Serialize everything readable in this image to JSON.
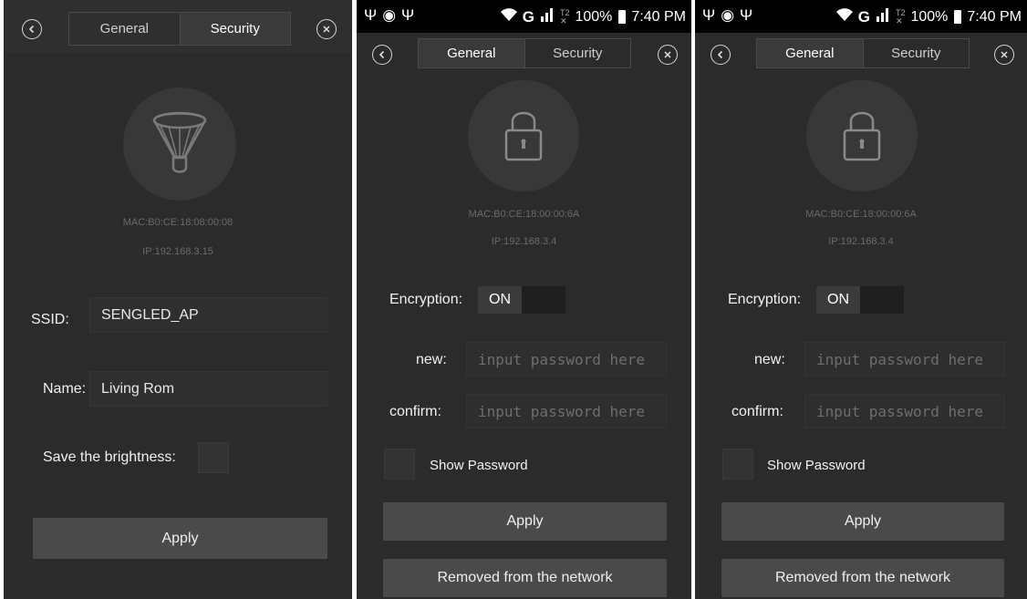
{
  "screen1": {
    "tabs": {
      "general": "General",
      "security": "Security"
    },
    "mac": "MAC:B0:CE:18:08:00:08",
    "ip": "IP:192.168.3.15",
    "ssid_label": "SSID:",
    "ssid_value": "SENGLED_AP",
    "name_label": "Name:",
    "name_value": "Living Rom",
    "save_brightness_label": "Save the brightness:",
    "apply_label": "Apply"
  },
  "screen2": {
    "status": {
      "battery": "100%",
      "time": "7:40 PM",
      "network": "G"
    },
    "tabs": {
      "general": "General",
      "security": "Security"
    },
    "mac": "MAC:B0:CE:18:00:00:6A",
    "ip": "IP:192.168.3.4",
    "encryption_label": "Encryption:",
    "toggle_on": "ON",
    "new_label": "new:",
    "new_placeholder": "input password here",
    "confirm_label": "confirm:",
    "confirm_placeholder": "input password here",
    "show_password_label": "Show Password",
    "apply_label": "Apply",
    "remove_label": "Removed from the network"
  },
  "screen3": {
    "status": {
      "battery": "100%",
      "time": "7:40 PM",
      "network": "G"
    },
    "tabs": {
      "general": "General",
      "security": "Security"
    },
    "mac": "MAC:B0:CE:18:00:00:6A",
    "ip": "IP:192.168.3.4",
    "encryption_label": "Encryption:",
    "toggle_on": "ON",
    "new_label": "new:",
    "new_placeholder": "input password here",
    "confirm_label": "confirm:",
    "confirm_placeholder": "input password here",
    "show_password_label": "Show Password",
    "apply_label": "Apply",
    "remove_label": "Removed from the network"
  },
  "icons": {
    "back": "chevron-left-icon",
    "close": "close-icon",
    "bulb": "bulb-icon",
    "lock": "lock-icon"
  },
  "colors": {
    "background": "#2b2b2b",
    "button": "#4a4a4a",
    "active_tab": "#3a3a3a",
    "dim_text": "#6b6b6b"
  }
}
